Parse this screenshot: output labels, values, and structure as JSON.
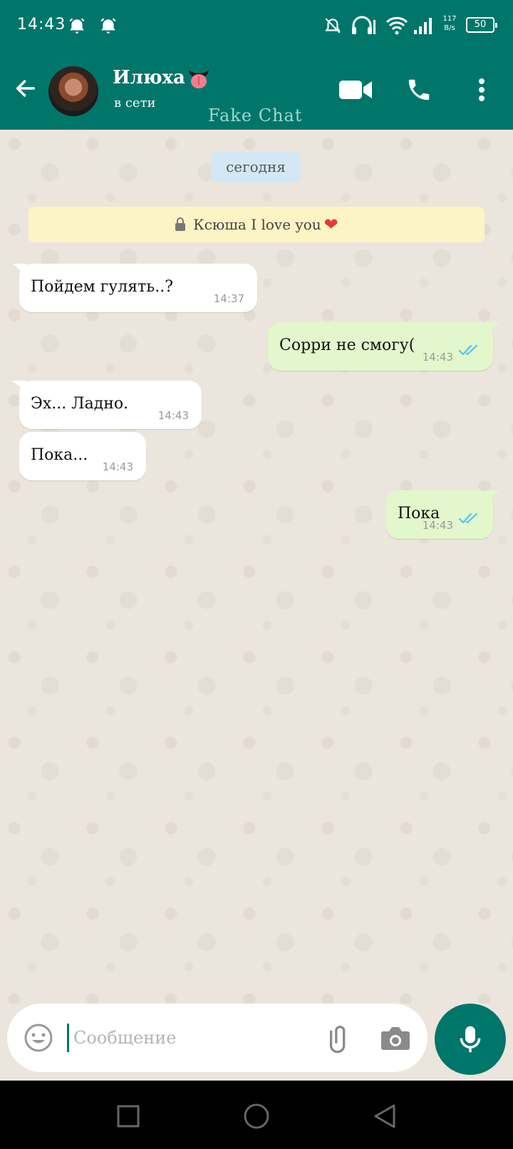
{
  "status_bar": {
    "time": "14:43",
    "net_speed_value": "117",
    "net_speed_unit": "B/s",
    "battery": "50"
  },
  "header": {
    "contact_name": "Илюха",
    "contact_status": "в сети",
    "watermark": "Fake Chat"
  },
  "chat": {
    "date_label": "сегодня",
    "notice": "Ксюша I love you",
    "messages": [
      {
        "direction": "in",
        "text": "Пойдем гулять..?",
        "time": "14:37"
      },
      {
        "direction": "out",
        "text": "Сорри не смогу(",
        "time": "14:43",
        "read": true
      },
      {
        "direction": "in",
        "text": "Эх... Ладно.",
        "time": "14:43"
      },
      {
        "direction": "in",
        "text": "Пока...",
        "time": "14:43"
      },
      {
        "direction": "out",
        "text": "Пока",
        "time": "14:43",
        "read": true
      }
    ]
  },
  "input": {
    "placeholder": "Сообщение"
  },
  "colors": {
    "primary": "#00766a",
    "chat_bg": "#ece5dd",
    "outgoing_bubble": "#e2f7cb",
    "incoming_bubble": "#ffffff",
    "read_ticks": "#4fc3f7"
  },
  "icons": [
    "bell-off-icon",
    "alarm-icon",
    "headphones-icon",
    "wifi-icon",
    "signal-icon",
    "battery-icon",
    "back-arrow-icon",
    "video-call-icon",
    "phone-icon",
    "more-vert-icon",
    "lock-icon",
    "heart-icon",
    "double-check-icon",
    "emoji-icon",
    "paperclip-icon",
    "camera-icon",
    "microphone-icon",
    "nav-recents-icon",
    "nav-home-icon",
    "nav-back-icon"
  ]
}
